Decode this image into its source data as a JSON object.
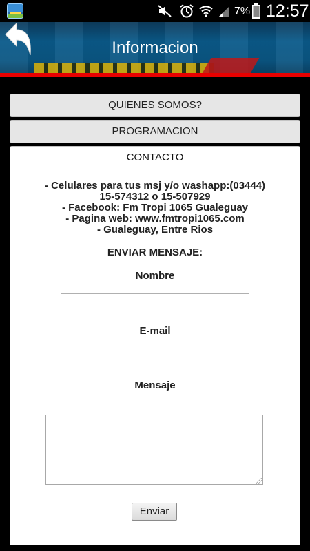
{
  "status_bar": {
    "battery_percent": "7%",
    "time": "12:57"
  },
  "header": {
    "title": "Informacion"
  },
  "accordion": {
    "sections": [
      {
        "label": "QUIENES SOMOS?"
      },
      {
        "label": "PROGRAMACION"
      },
      {
        "label": "CONTACTO"
      }
    ]
  },
  "contact": {
    "lines": [
      "- Celulares para tus msj y/o washapp:(03444)",
      "15-574312 o 15-507929",
      "- Facebook: Fm Tropi 1065 Gualeguay",
      "- Pagina web: www.fmtropi1065.com",
      "- Gualeguay, Entre Rios"
    ]
  },
  "form": {
    "heading": "ENVIAR MENSAJE:",
    "name_label": "Nombre",
    "email_label": "E-mail",
    "message_label": "Mensaje",
    "submit_label": "Enviar"
  }
}
